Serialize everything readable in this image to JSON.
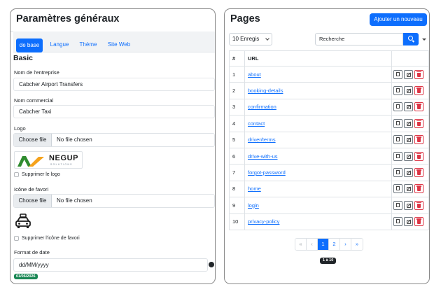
{
  "left": {
    "title": "Paramètres généraux",
    "tabs": [
      "de base",
      "Langue",
      "Thème",
      "Site Web"
    ],
    "section_title": "Basic",
    "company_label": "Nom de l'entreprise",
    "company_value": "Cabcher Airport Transfers",
    "trade_label": "Nom commercial",
    "trade_value": "Cabcher Taxi",
    "logo_label": "Logo",
    "file_button": "Choose file",
    "no_file": "No file chosen",
    "logo_brand": "NEGUP",
    "logo_sub": "SOLUTIONS",
    "delete_logo": "Supprimer le logo",
    "favicon_label": "Icône de favori",
    "delete_favicon": "Supprimer l'icône de favori",
    "date_label": "Format de date",
    "date_value": "dd/MM/yyyy",
    "date_preview": "01/06/2026"
  },
  "right": {
    "title": "Pages",
    "add_button": "Ajouter un nouveau",
    "length_select": "10 Enregis",
    "search_placeholder": "Recherche",
    "columns": [
      "#",
      "URL",
      ""
    ],
    "rows": [
      {
        "num": "1",
        "url": "about"
      },
      {
        "num": "2",
        "url": "booking-details"
      },
      {
        "num": "3",
        "url": "confirmation"
      },
      {
        "num": "4",
        "url": "contact"
      },
      {
        "num": "5",
        "url": "driver/terms"
      },
      {
        "num": "6",
        "url": "drive-with-us"
      },
      {
        "num": "7",
        "url": "forgot-password"
      },
      {
        "num": "8",
        "url": "home"
      },
      {
        "num": "9",
        "url": "login"
      },
      {
        "num": "10",
        "url": "privacy-policy"
      }
    ],
    "pagination": [
      "«",
      "‹",
      "1",
      "2",
      "›",
      "»"
    ],
    "info": "1 à 10"
  },
  "colors": {
    "primary": "#0d6efd",
    "danger": "#dc3545",
    "success": "#198754",
    "logo_green": "#2e8b2e",
    "logo_orange": "#f5a21b"
  },
  "icons": [
    "copy-icon",
    "edit-icon",
    "trash-icon",
    "search-icon",
    "taxi-icon",
    "calendar-icon"
  ]
}
